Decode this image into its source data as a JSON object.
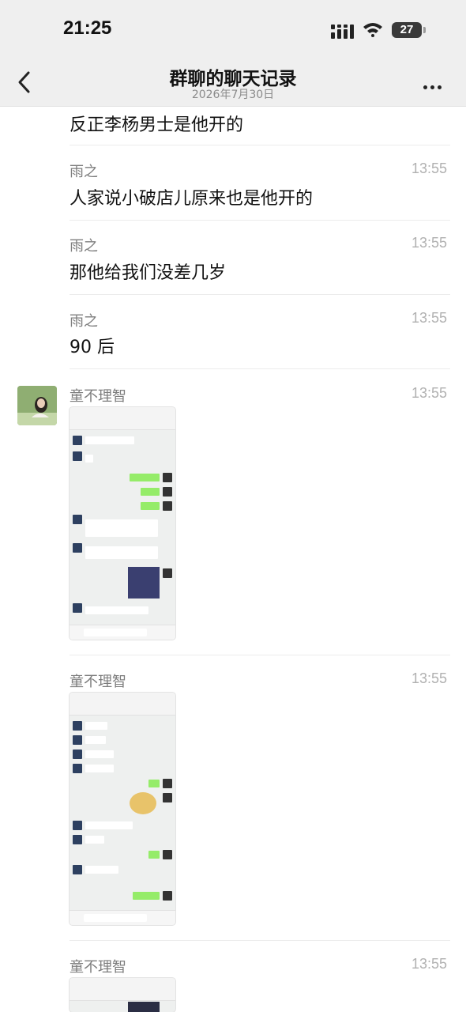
{
  "status_bar": {
    "time": "21:25",
    "battery": "27"
  },
  "header": {
    "title": "群聊的聊天记录",
    "date": "2026年7月30日"
  },
  "messages": [
    {
      "text": "反正李杨男士是他开的"
    },
    {
      "sender": "雨之",
      "time": "13:55",
      "text": "人家说小破店儿原来也是他开的"
    },
    {
      "sender": "雨之",
      "time": "13:55",
      "text": "那他给我们没差几岁"
    },
    {
      "sender": "雨之",
      "time": "13:55",
      "text": "90 后"
    },
    {
      "sender": "童不理智",
      "time": "13:55"
    },
    {
      "sender": "童不理智",
      "time": "13:55"
    },
    {
      "sender": "童不理智",
      "time": "13:55"
    }
  ],
  "icons": {
    "back": "chevron-left-icon",
    "more": "more-dots-icon",
    "signal": "signal-icon",
    "wifi": "wifi-icon",
    "battery": "battery-icon"
  },
  "colors": {
    "bar_bg": "#efefef",
    "bubble_green": "#95ec69",
    "time_gray": "#b0b0b0"
  }
}
